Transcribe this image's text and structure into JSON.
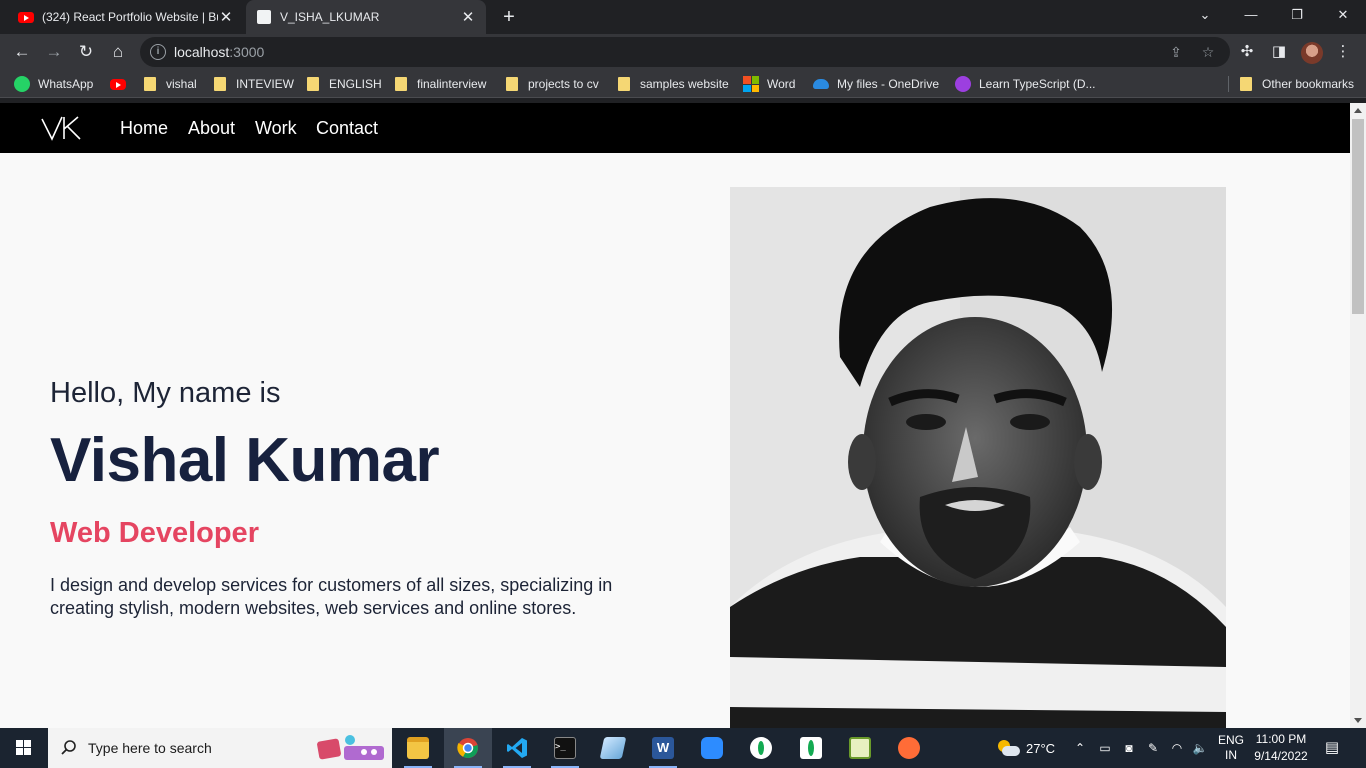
{
  "browser": {
    "tabs": [
      {
        "title": "(324) React Portfolio Website | Bu",
        "icon": "youtube-icon",
        "active": false
      },
      {
        "title": "V_ISHA_LKUMAR",
        "icon": "page-icon",
        "active": true
      }
    ],
    "address": {
      "host": "localhost",
      "port": ":3000"
    },
    "bookmarks": [
      {
        "label": "WhatsApp",
        "icon": "whatsapp-icon"
      },
      {
        "label": "",
        "icon": "youtube-icon"
      },
      {
        "label": "vishal",
        "icon": "folder-icon"
      },
      {
        "label": "INTEVIEW",
        "icon": "folder-icon"
      },
      {
        "label": "ENGLISH",
        "icon": "folder-icon"
      },
      {
        "label": "finalinterview",
        "icon": "folder-icon"
      },
      {
        "label": "projects to cv",
        "icon": "folder-icon"
      },
      {
        "label": "samples website",
        "icon": "folder-icon"
      },
      {
        "label": "Word",
        "icon": "microsoft-icon"
      },
      {
        "label": "My files - OneDrive",
        "icon": "onedrive-icon"
      },
      {
        "label": "Learn TypeScript (D...",
        "icon": "typescript-icon"
      }
    ],
    "other_bookmarks": "Other bookmarks"
  },
  "site": {
    "logo_text": "VK",
    "nav": [
      "Home",
      "About",
      "Work",
      "Contact"
    ],
    "hero": {
      "greeting": "Hello, My name is",
      "name": "Vishal Kumar",
      "role": "Web Developer",
      "description": "I design and develop services for customers of all sizes, specializing in creating stylish, modern websites, web services and online stores."
    },
    "colors": {
      "nav_bg": "#000000",
      "name": "#17213e",
      "role": "#e54561",
      "page_bg": "#f9f9f9"
    }
  },
  "taskbar": {
    "search_placeholder": "Type here to search",
    "weather": "27°C",
    "language": "ENG",
    "region": "IN",
    "time": "11:00 PM",
    "date": "9/14/2022"
  }
}
